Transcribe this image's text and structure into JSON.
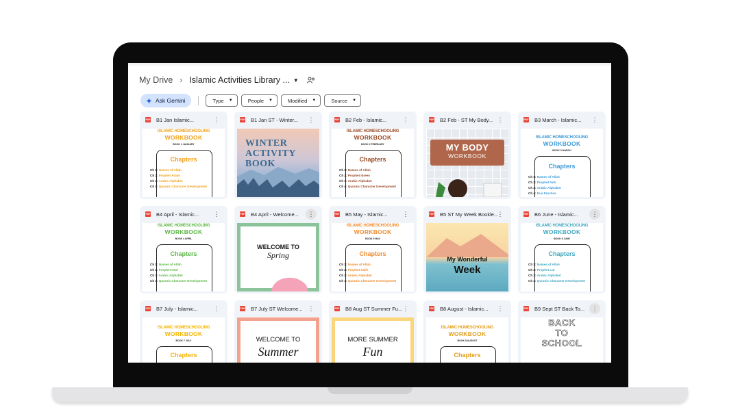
{
  "breadcrumb": {
    "root": "My Drive",
    "folder": "Islamic Activities Library ..."
  },
  "filters": {
    "gemini": "Ask Gemini",
    "chips": [
      "Type",
      "People",
      "Modified",
      "Source"
    ]
  },
  "pdf_badge": "PDF",
  "workbook": {
    "series": "ISLAMIC HOMESCHOOLING",
    "title": "WORKBOOK",
    "chapters_heading": "Chapters"
  },
  "files": [
    {
      "title": "B1 Jan Islamic...",
      "book": "BOOK 1 JANUARY",
      "chapters": [
        "Names of Allah",
        "Prophet Adam",
        "Arabic Alphabet",
        "Quranic Character Development"
      ]
    },
    {
      "title": "B1 Jan ST - Winter...",
      "cover": [
        "WINTER",
        "ACTIVITY",
        "BOOK"
      ]
    },
    {
      "title": "B2 Feb - Islamic...",
      "book": "BOOK 2 FEBRUARY",
      "chapters": [
        "Names of Allah",
        "Prophet Idrees",
        "Arabic Alphabet",
        "Quranic Character Development"
      ]
    },
    {
      "title": "B2 Feb - ST My Body...",
      "cover": [
        "MY BODY",
        "WORKBOOK"
      ]
    },
    {
      "title": "B3 March - Islamic...",
      "book": "BOOK 3 MARCH",
      "chapters": [
        "Names of Allah",
        "Prophet Nuh",
        "Arabic Alphabet",
        "Dua Practice"
      ]
    },
    {
      "title": "B4 April - Islamic...",
      "book": "BOOK 4 APRIL",
      "chapters": [
        "Names of Allah",
        "Prophet Hud",
        "Arabic Alphabet",
        "Quranic Character Development"
      ]
    },
    {
      "title": "B4 April - Welcome...",
      "cover": [
        "WELCOME TO",
        "Spring"
      ]
    },
    {
      "title": "B5 May - Islamic...",
      "book": "BOOK 5 MAY",
      "chapters": [
        "Names of Allah",
        "Prophet Salih",
        "Arabic Alphabet",
        "Quranic Character Development"
      ]
    },
    {
      "title": "B5 ST My Week Bookle...",
      "cover": [
        "My Wonderful",
        "Week"
      ]
    },
    {
      "title": "B6 June - Islamic...",
      "book": "BOOK 6 JUNE",
      "chapters": [
        "Names of Allah",
        "Prophet Lut",
        "Arabic Alphabet",
        "Quranic Character Development"
      ]
    },
    {
      "title": "B7 July - Islamic...",
      "book": "BOOK 7 JULY",
      "chapters": []
    },
    {
      "title": "B7 July ST Welcome...",
      "cover": [
        "WELCOME TO",
        "Summer"
      ]
    },
    {
      "title": "B8 Aug ST Summer Fu...",
      "cover": [
        "MORE SUMMER",
        "Fun"
      ]
    },
    {
      "title": "B8 August - Islamic...",
      "book": "BOOK 8 AUGUST",
      "chapters": []
    },
    {
      "title": "B9 Sept ST Back To...",
      "cover": [
        "BACK",
        "TO",
        "SCHOOL"
      ]
    }
  ],
  "colors": {
    "jan": "#f0a21b",
    "feb": "#9a4b26",
    "mar": "#3d9ad6",
    "apr": "#5bb645",
    "may": "#ef8a2f",
    "jun": "#3ea7bf",
    "jul": "#f4b400",
    "aug": "#e39e1a"
  }
}
